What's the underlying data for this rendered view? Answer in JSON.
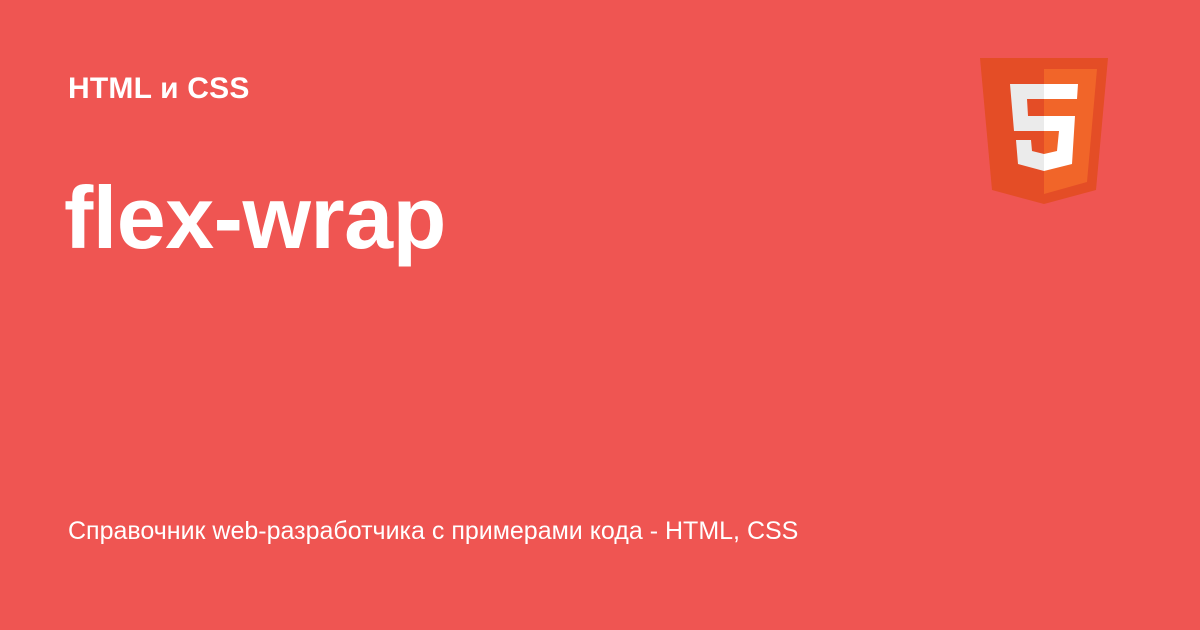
{
  "category": "HTML и CSS",
  "title": "flex-wrap",
  "subtitle": "Справочник web-разработчика с примерами кода - HTML, CSS",
  "logo": {
    "icon": "html5-logo-icon",
    "colors": {
      "shield_dark": "#E44D26",
      "shield_light": "#F16529",
      "glyph_white": "#FFFFFF",
      "glyph_gray": "#EBEBEB"
    }
  },
  "colors": {
    "background": "#EF5552",
    "text": "#FFFFFF"
  }
}
